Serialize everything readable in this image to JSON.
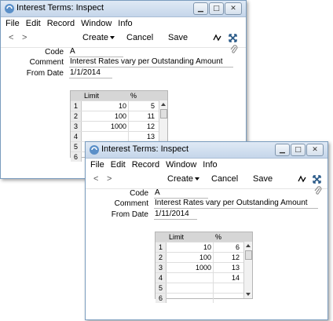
{
  "windows": [
    {
      "title": "Interest Terms: Inspect",
      "menu": [
        "File",
        "Edit",
        "Record",
        "Window",
        "Info"
      ],
      "toolbar": {
        "prev": "<",
        "next": ">",
        "create": "Create",
        "cancel": "Cancel",
        "save": "Save"
      },
      "fields": {
        "code_label": "Code",
        "code_value": "A",
        "comment_label": "Comment",
        "comment_value": "Interest Rates vary per Outstanding Amount",
        "from_date_label": "From Date",
        "from_date_value": "1/1/2014"
      },
      "grid": {
        "headers": [
          "Limit",
          "%"
        ],
        "rows": [
          {
            "n": "1",
            "limit": "10",
            "pct": "5"
          },
          {
            "n": "2",
            "limit": "100",
            "pct": "11"
          },
          {
            "n": "3",
            "limit": "1000",
            "pct": "12"
          },
          {
            "n": "4",
            "limit": "",
            "pct": "13"
          },
          {
            "n": "5",
            "limit": "",
            "pct": ""
          },
          {
            "n": "6",
            "limit": "",
            "pct": ""
          }
        ]
      }
    },
    {
      "title": "Interest Terms: Inspect",
      "menu": [
        "File",
        "Edit",
        "Record",
        "Window",
        "Info"
      ],
      "toolbar": {
        "prev": "<",
        "next": ">",
        "create": "Create",
        "cancel": "Cancel",
        "save": "Save"
      },
      "fields": {
        "code_label": "Code",
        "code_value": "A",
        "comment_label": "Comment",
        "comment_value": "Interest Rates vary per Outstanding Amount",
        "from_date_label": "From Date",
        "from_date_value": "1/11/2014"
      },
      "grid": {
        "headers": [
          "Limit",
          "%"
        ],
        "rows": [
          {
            "n": "1",
            "limit": "10",
            "pct": "6"
          },
          {
            "n": "2",
            "limit": "100",
            "pct": "12"
          },
          {
            "n": "3",
            "limit": "1000",
            "pct": "13"
          },
          {
            "n": "4",
            "limit": "",
            "pct": "14"
          },
          {
            "n": "5",
            "limit": "",
            "pct": ""
          },
          {
            "n": "6",
            "limit": "",
            "pct": ""
          }
        ]
      }
    }
  ],
  "icons": {
    "app": "app-swirl-icon",
    "minimize": "minimize-icon",
    "maximize": "maximize-icon",
    "close": "close-icon",
    "signature": "signature-icon",
    "expand": "expand-arrows-icon",
    "attachment": "paperclip-icon"
  },
  "colors": {
    "titlebar_top": "#dfe9f5",
    "titlebar_bottom": "#c5d6ea",
    "window_border": "#7a9cbe",
    "grid_header": "#d6d6d6",
    "expand_icon": "#2a5a88"
  }
}
